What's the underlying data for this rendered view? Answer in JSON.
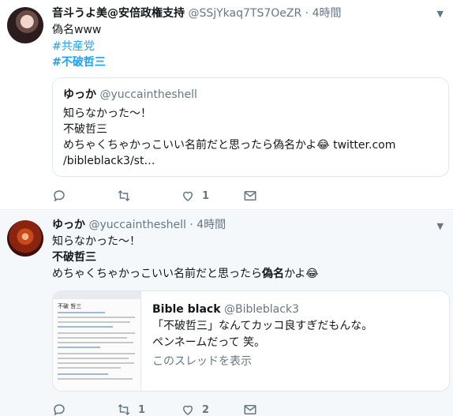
{
  "tweet1": {
    "name": "音斗うよ美@安倍政権支持",
    "handle": "@SSjYkaq7TS7OeZR",
    "dot": "·",
    "time": "4時間",
    "text": "偽名www",
    "hashtags": [
      "#共産党",
      "#不破哲三"
    ],
    "quote": {
      "name": "ゆっか",
      "handle": "@yuccaintheshell",
      "lines": [
        "知らなかった〜！",
        "不破哲三",
        "めちゃくちゃかっこいい名前だと思ったら偽名かよ😂 twitter.com",
        "/bibleblack3/st…"
      ]
    },
    "actions": {
      "reply_count": "",
      "retweet_count": "",
      "like_count": "1"
    }
  },
  "tweet2": {
    "name": "ゆっか",
    "handle": "@yuccaintheshell",
    "dot": "·",
    "time": "4時間",
    "line1": "知らなかった〜！",
    "line2": "不破哲三",
    "line3_pre": "めちゃくちゃかっこいい名前だと思ったら",
    "line3_bold": "偽名",
    "line3_post": "かよ😂",
    "card": {
      "name": "Bible black",
      "handle": "@Bibleblack3",
      "line1": "「不破哲三」なんてカッコ良すぎだもんな。",
      "line2": "ペンネームだって 笑。",
      "thread_link": "このスレッドを表示",
      "thumb_title": "不破 哲三"
    },
    "actions": {
      "reply_count": "",
      "retweet_count": "1",
      "like_count": "2"
    }
  },
  "colors": {
    "link": "#1da1f2",
    "secondary": "#657786",
    "text": "#14171a"
  },
  "icons": [
    "reply-icon",
    "retweet-icon",
    "like-icon",
    "message-icon",
    "chevron-down-icon"
  ]
}
